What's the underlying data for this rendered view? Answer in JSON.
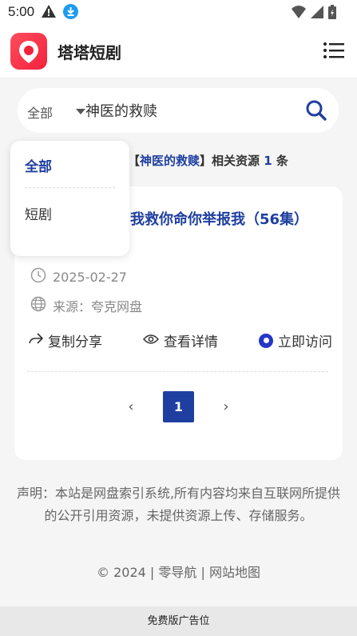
{
  "status_bar": {
    "time": "5:00",
    "icons": [
      "warning-icon",
      "download-icon",
      "wifi-icon",
      "signal-icon",
      "battery-icon"
    ]
  },
  "header": {
    "site_title": "塔塔短剧",
    "logo_icon": "map-pin-logo",
    "menu_icon": "menu-icon",
    "brand_color": "#f2213c"
  },
  "search": {
    "scope": "全部",
    "value": "神医的救赎",
    "search_icon": "search-icon",
    "accent_color": "#1f3fa0"
  },
  "dropdown": {
    "options": [
      "全部",
      "短剧"
    ],
    "selected": "全部"
  },
  "summary": {
    "prefix": "【",
    "keyword": "神医的救赎",
    "middle": "】相关资源 ",
    "count": "1",
    "suffix": " 条"
  },
  "result": {
    "title": "我救你命你举报我（56集）",
    "date": "2025-02-27",
    "source": "来源：夸克网盘",
    "actions": {
      "share": "复制分享",
      "detail": "查看详情",
      "visit": "立即访问"
    }
  },
  "pagination": {
    "prev": "‹",
    "current": "1",
    "next": "›"
  },
  "footer": {
    "disclaimer": "声明：本站是网盘索引系统,所有内容均来自互联网所提供的公开引用资源，未提供资源上传、存储服务。",
    "copyright": "© 2024 | 零导航 | 网站地图",
    "ad": "免费版广告位"
  }
}
